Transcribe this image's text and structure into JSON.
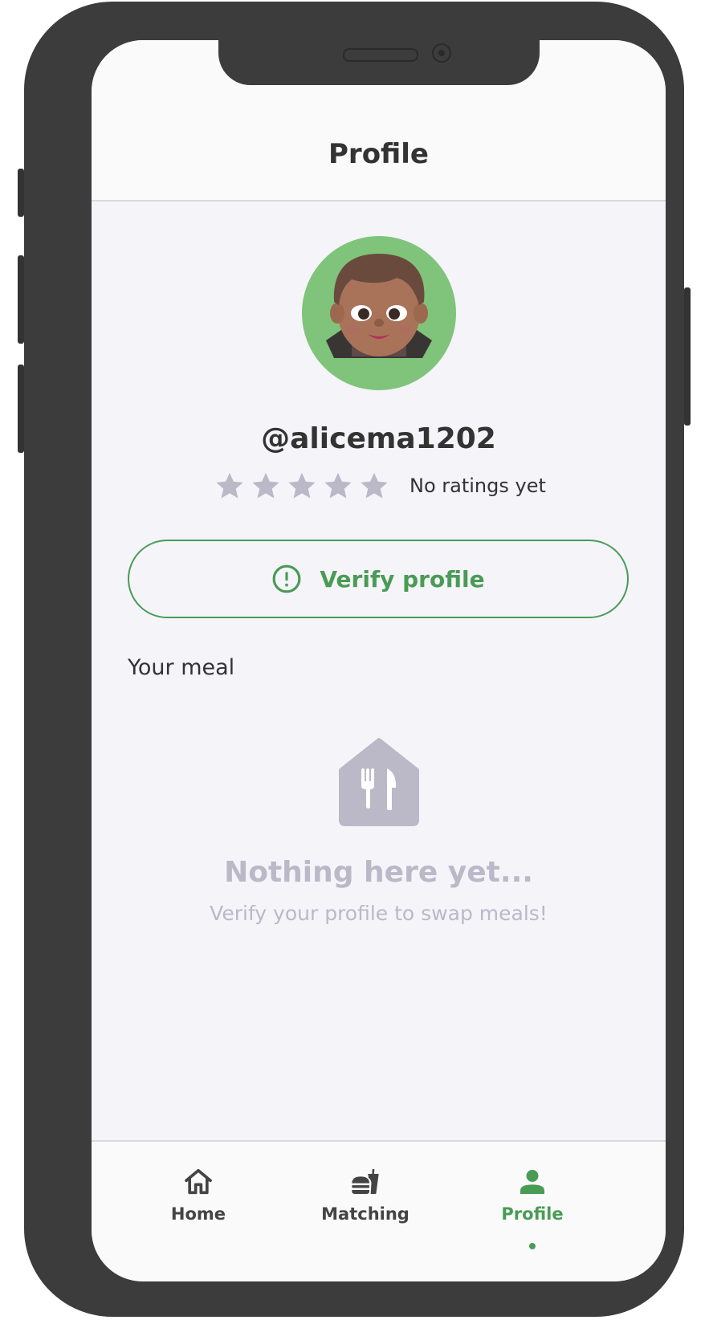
{
  "header": {
    "title": "Profile"
  },
  "profile": {
    "username": "@alicema1202",
    "rating_stars": 0,
    "rating_max": 5,
    "rating_text": "No ratings yet"
  },
  "verify_button": {
    "label": "Verify profile",
    "icon": "alert-circle-icon"
  },
  "meal_section": {
    "title": "Your meal",
    "empty_title": "Nothing here yet...",
    "empty_subtitle": "Verify your profile to swap meals!",
    "icon": "restaurant-icon"
  },
  "tabbar": {
    "active": "Profile",
    "items": [
      {
        "label": "Home",
        "icon": "home-icon"
      },
      {
        "label": "Matching",
        "icon": "fastfood-icon"
      },
      {
        "label": "Profile",
        "icon": "person-icon"
      }
    ]
  },
  "colors": {
    "accent": "#4a9b55",
    "avatar_bg": "#7fc47a",
    "muted": "#bbb8c8",
    "star_empty": "#bbb8c8"
  }
}
